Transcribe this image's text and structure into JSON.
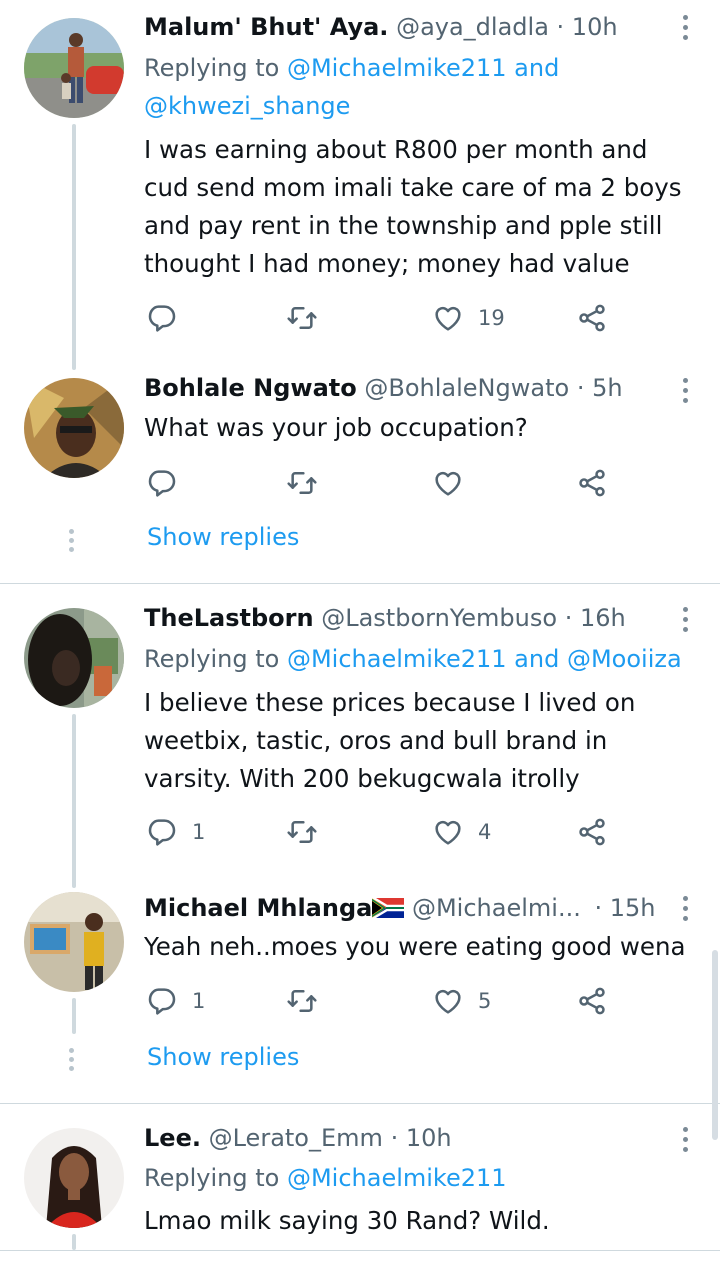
{
  "tweets": [
    {
      "name": "Malum' Bhut' Aya.",
      "handle": "@aya_dladla",
      "time": "· 10h",
      "replying_prefix": "Replying to",
      "replying_to": "@Michaelmike211 and",
      "replying_to_line2": "@khwezi_shange",
      "text_lines": [
        "I was earning about R800 per month and",
        "cud send mom imali take care of ma 2 boys",
        "and pay rent in the township and pple still",
        "thought I had money; money had value"
      ],
      "reply_count": "",
      "retweet_count": "",
      "like_count": "19"
    },
    {
      "name": "Bohlale Ngwato",
      "handle": "@BohlaleNgwato",
      "time": "· 5h",
      "text": "What was your job occupation?",
      "reply_count": "",
      "like_count": "",
      "show_replies": "Show replies"
    },
    {
      "name": "TheLastborn",
      "handle": "@LastbornYembuso",
      "time": "· 16h",
      "replying_prefix": "Replying to",
      "replying_to": "@Michaelmike211 and @Mooiiza",
      "text_lines": [
        "I believe these prices because I lived on",
        "weetbix, tastic, oros and bull brand in",
        "varsity. With 200 bekugcwala itrolly"
      ],
      "reply_count": "1",
      "like_count": "4"
    },
    {
      "name": "Michael Mhlanga",
      "handle": "@Michaelmi...",
      "time": "· 15h",
      "text": "Yeah neh..moes you were eating good wena",
      "reply_count": "1",
      "like_count": "5",
      "show_replies": "Show replies"
    },
    {
      "name": "Lee.",
      "handle": "@Lerato_Emm",
      "time": "· 10h",
      "replying_prefix": "Replying to",
      "replying_to": "@Michaelmike211",
      "text": "Lmao milk saying 30 Rand? Wild."
    }
  ],
  "icons": {
    "reply": "reply-icon",
    "retweet": "retweet-icon",
    "like": "heart-icon",
    "share": "share-icon",
    "more": "more-vertical-icon"
  },
  "colors": {
    "link": "#1d9bf0",
    "secondary": "#536471",
    "text": "#0f1419",
    "divider": "#cfd9de"
  }
}
